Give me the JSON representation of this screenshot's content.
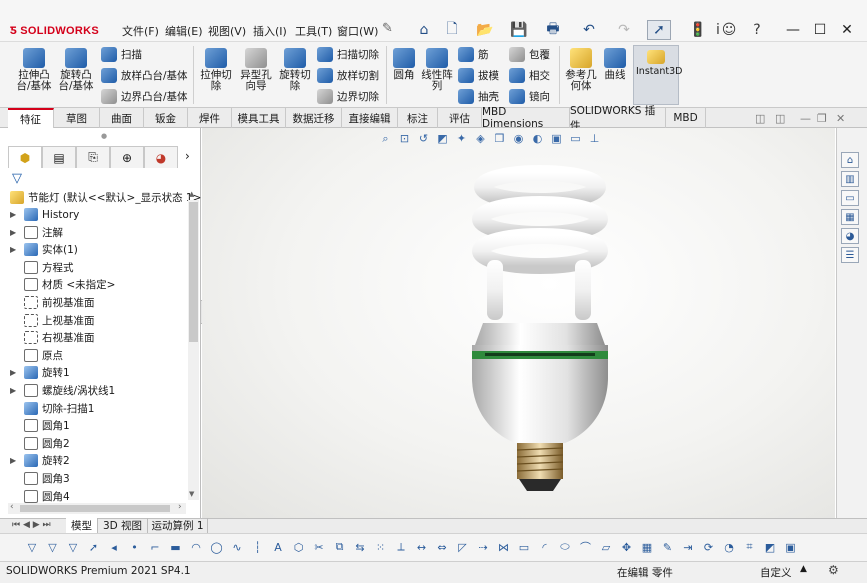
{
  "app": {
    "logo_text": "SOLIDWORKS",
    "menu": [
      "文件(F)",
      "编辑(E)",
      "视图(V)",
      "插入(I)",
      "工具(T)",
      "窗口(W)"
    ],
    "toolbar_icons": [
      "home-icon",
      "new-document-icon",
      "open-icon",
      "save-icon",
      "print-icon",
      "undo-icon",
      "redo-icon",
      "select-pointer-icon",
      "traffic-light-icon",
      "info-icon",
      "user-icon",
      "help-icon"
    ],
    "info_label": "i"
  },
  "window_controls": [
    "—",
    "☐",
    "✕"
  ],
  "ribbon": {
    "big_buttons": [
      {
        "label": "拉伸凸\n台/基体",
        "icon": "extrude-boss-icon"
      },
      {
        "label": "旋转凸\n台/基体",
        "icon": "revolve-boss-icon"
      },
      {
        "label": "拉伸切\n除",
        "icon": "extrude-cut-icon"
      },
      {
        "label": "异型孔\n向导",
        "icon": "hole-wizard-icon"
      },
      {
        "label": "旋转切\n除",
        "icon": "revolve-cut-icon"
      },
      {
        "label": "圆角",
        "icon": "fillet-icon"
      },
      {
        "label": "线性阵\n列",
        "icon": "linear-pattern-icon"
      },
      {
        "label": "参考几\n何体",
        "icon": "reference-geometry-icon"
      },
      {
        "label": "曲线",
        "icon": "curves-icon"
      },
      {
        "label": "Instant3D",
        "icon": "instant3d-icon"
      }
    ],
    "small_buttons": [
      {
        "label": "扫描",
        "icon": "sweep-icon"
      },
      {
        "label": "放样凸台/基体",
        "icon": "loft-icon"
      },
      {
        "label": "边界凸台/基体",
        "icon": "boundary-boss-icon"
      },
      {
        "label": "扫描切除",
        "icon": "swept-cut-icon"
      },
      {
        "label": "放样切割",
        "icon": "lofted-cut-icon"
      },
      {
        "label": "边界切除",
        "icon": "boundary-cut-icon"
      },
      {
        "label": "筋",
        "icon": "rib-icon"
      },
      {
        "label": "拔模",
        "icon": "draft-icon"
      },
      {
        "label": "抽壳",
        "icon": "shell-icon"
      },
      {
        "label": "包覆",
        "icon": "wrap-icon"
      },
      {
        "label": "相交",
        "icon": "intersect-icon"
      },
      {
        "label": "镜向",
        "icon": "mirror-icon"
      }
    ]
  },
  "tabs": [
    "特征",
    "草图",
    "曲面",
    "钣金",
    "焊件",
    "模具工具",
    "数据迁移",
    "直接编辑",
    "标注",
    "评估",
    "MBD Dimensions",
    "SOLIDWORKS 插件",
    "MBD"
  ],
  "feature_tree": {
    "root": "节能灯  (默认<<默认>_显示状态 1>",
    "items": [
      {
        "label": "History",
        "expandable": true
      },
      {
        "label": "注解",
        "expandable": true
      },
      {
        "label": "实体(1)",
        "expandable": true
      },
      {
        "label": "方程式",
        "expandable": false
      },
      {
        "label": "材质 <未指定>",
        "expandable": false
      },
      {
        "label": "前视基准面",
        "expandable": false
      },
      {
        "label": "上视基准面",
        "expandable": false
      },
      {
        "label": "右视基准面",
        "expandable": false
      },
      {
        "label": "原点",
        "expandable": false
      },
      {
        "label": "旋转1",
        "expandable": true
      },
      {
        "label": "螺旋线/涡状线1",
        "expandable": true
      },
      {
        "label": "切除-扫描1",
        "expandable": false
      },
      {
        "label": "圆角1",
        "expandable": false
      },
      {
        "label": "圆角2",
        "expandable": false
      },
      {
        "label": "旋转2",
        "expandable": true
      },
      {
        "label": "圆角3",
        "expandable": false
      },
      {
        "label": "圆角4",
        "expandable": false
      }
    ]
  },
  "bottom_tabs": [
    "模型",
    "3D 视图",
    "运动算例 1"
  ],
  "status": {
    "product": "SOLIDWORKS Premium 2021 SP4.1",
    "mode": "在编辑 零件",
    "units": "自定义"
  },
  "colors": {
    "brand_red": "#d4001a",
    "accent_blue": "#1f5ca8",
    "bulb_band_green": "#2f8a3c"
  }
}
